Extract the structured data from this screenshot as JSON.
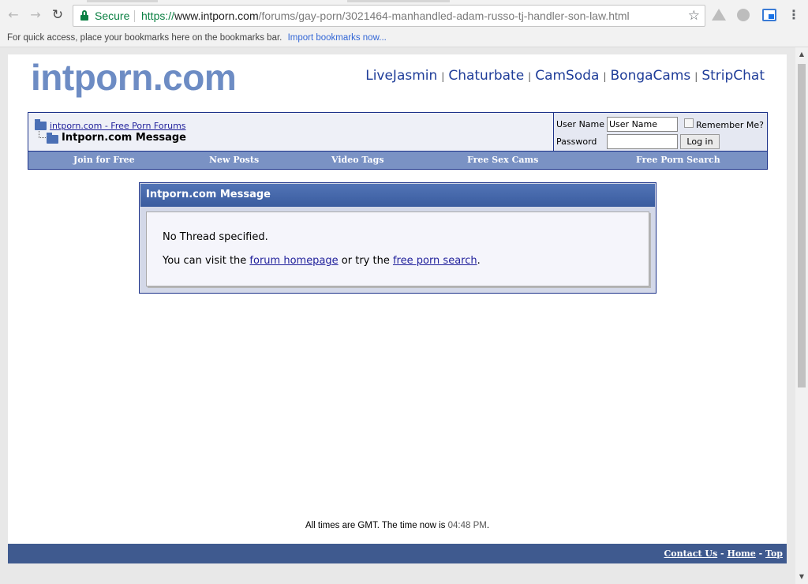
{
  "browser": {
    "secure_label": "Secure",
    "url_scheme": "https://",
    "url_host": "www.intporn.com",
    "url_path": "/forums/gay-porn/3021464-manhandled-adam-russo-tj-handler-son-law.html",
    "bookmarks_prompt": "For quick access, place your bookmarks here on the bookmarks bar.",
    "import_link": "Import bookmarks now...",
    "icons": [
      "back-arrow-icon",
      "forward-arrow-icon",
      "reload-icon",
      "lock-icon",
      "star-icon",
      "drive-icon",
      "globe-icon",
      "cast-icon",
      "menu-icon"
    ]
  },
  "site": {
    "logo": "intporn.com",
    "cam_links": [
      "LiveJasmin",
      "Chaturbate",
      "CamSoda",
      "BongaCams",
      "StripChat"
    ],
    "cam_sep": "|"
  },
  "navbar": {
    "breadcrumb_link": "intporn.com - Free Porn Forums",
    "breadcrumb_current": "Intporn.com Message",
    "username_label": "User Name",
    "username_value": "User Name",
    "password_label": "Password",
    "remember_label": "Remember Me?",
    "login_button": "Log in",
    "links": [
      "Join for Free",
      "New Posts",
      "Video Tags",
      "Free Sex Cams",
      "Free Porn Search"
    ]
  },
  "message": {
    "title": "Intporn.com Message",
    "line1": "No Thread specified.",
    "line2_prefix": "You can visit the ",
    "homepage_link": "forum homepage",
    "line2_mid": " or try the ",
    "search_link": "free porn search",
    "line2_suffix": "."
  },
  "footer": {
    "time_prefix": "All times are GMT. The time now is ",
    "time_value": "04:48 PM",
    "time_suffix": ".",
    "contact": "Contact Us",
    "home": "Home",
    "top": "Top",
    "sep": " - "
  },
  "colors": {
    "logo": "#6d8cc4",
    "navbar_border": "#1c3289",
    "navbar_links_bg": "#7a92c4",
    "message_header": "#3e65aa",
    "footer_bar": "#3f5a8f",
    "secure_green": "#0b8043"
  }
}
